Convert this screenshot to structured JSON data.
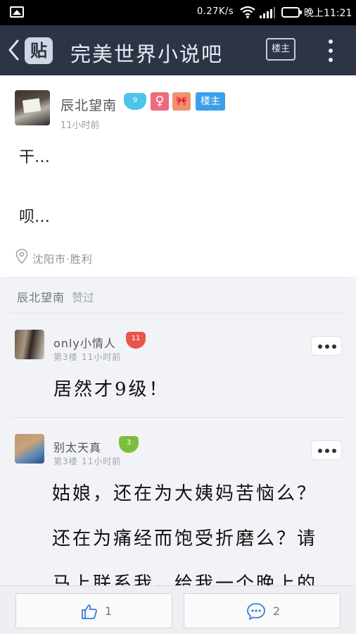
{
  "status_bar": {
    "speed": "0.27K/s",
    "time": "晚上11:21"
  },
  "nav": {
    "logo_text": "贴",
    "title": "完美世界小说吧",
    "owner_button": "楼主"
  },
  "post": {
    "author": "辰北望南",
    "level": "9",
    "female_badge": "♀",
    "bow_badge": "🎀",
    "owner_badge": "楼主",
    "time": "11小时前",
    "body_line1": "干…",
    "body_line2": "呗…",
    "location": "沈阳市·胜利"
  },
  "likes": {
    "name": "辰北望南",
    "label": "赞过"
  },
  "replies": [
    {
      "name": "only小情人",
      "level": "11",
      "level_color": "#e9554a",
      "floor": "第3楼",
      "time": "11小时前",
      "lines": [
        "居然才9级！"
      ]
    },
    {
      "name": "别太天真",
      "level": "3",
      "level_color": "#7cbd3c",
      "floor": "第3楼",
      "time": "11小时前",
      "lines": [
        "姑娘，还在为大姨妈苦恼么？",
        "还在为痛经而饱受折磨么？请",
        "马上联系我，给我一个晚上的"
      ]
    }
  ],
  "bottom_bar": {
    "like_count": "1",
    "comment_count": "2"
  }
}
